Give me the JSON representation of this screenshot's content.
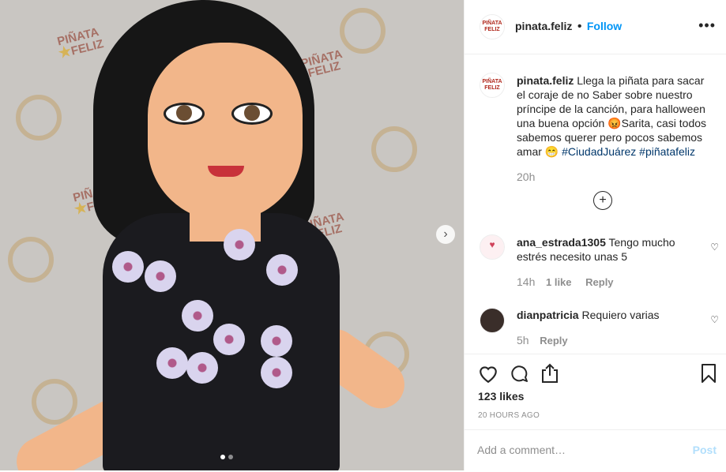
{
  "post": {
    "username": "pinata.feliz",
    "follow_label": "Follow",
    "separator": "•",
    "more_label": "•••",
    "caption": {
      "username": "pinata.feliz",
      "text": "Llega la piñata para sacar el coraje de no Saber sobre nuestro príncipe de la canción, para halloween una buena opción 😡Sarita, casi todos sabemos querer pero pocos sabemos amar 😁",
      "hashtags": [
        "#CiudadJuárez",
        "#piñatafeliz"
      ],
      "time": "20h"
    },
    "load_more": "⊕",
    "comments": [
      {
        "username": "ana_estrada1305",
        "text": "Tengo mucho estrés necesito unas 5",
        "time": "14h",
        "likes": "1 like",
        "reply": "Reply"
      },
      {
        "username": "dianpatricia",
        "text": "Requiero varias",
        "time": "5h",
        "reply": "Reply"
      }
    ],
    "likes": "123 likes",
    "timestamp": "20 HOURS AGO",
    "add_comment_placeholder": "Add a comment…",
    "post_button": "Post"
  },
  "watermark": {
    "line1": "PIÑATA",
    "line2": "FELIZ"
  },
  "carousel": {
    "next": "›"
  },
  "colors": {
    "link": "#0095f6",
    "hashtag": "#00376b",
    "muted": "#8e8e8e"
  }
}
